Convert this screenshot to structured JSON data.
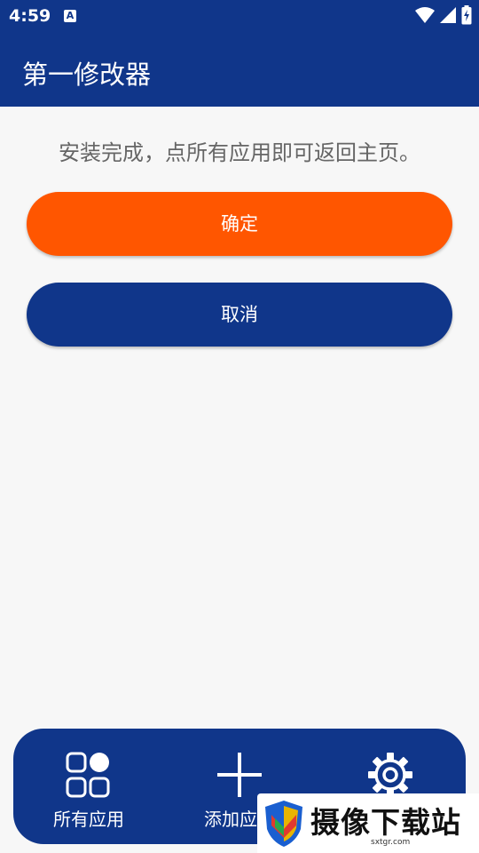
{
  "status_bar": {
    "time": "4:59",
    "notification_badge": "A"
  },
  "app_bar": {
    "title": "第一修改器"
  },
  "main": {
    "message": "安装完成，点所有应用即可返回主页。",
    "confirm_label": "确定",
    "cancel_label": "取消"
  },
  "bottom_nav": {
    "items": [
      {
        "label": "所有应用",
        "icon": "apps-grid-icon"
      },
      {
        "label": "添加应用",
        "icon": "plus-icon"
      },
      {
        "label": "设置",
        "icon": "gear-icon"
      }
    ]
  },
  "watermark": {
    "text": "摄像下载站",
    "url": "sxtgr.com"
  },
  "colors": {
    "primary": "#10368a",
    "accent": "#ff5600",
    "background": "#f7f7f7"
  }
}
